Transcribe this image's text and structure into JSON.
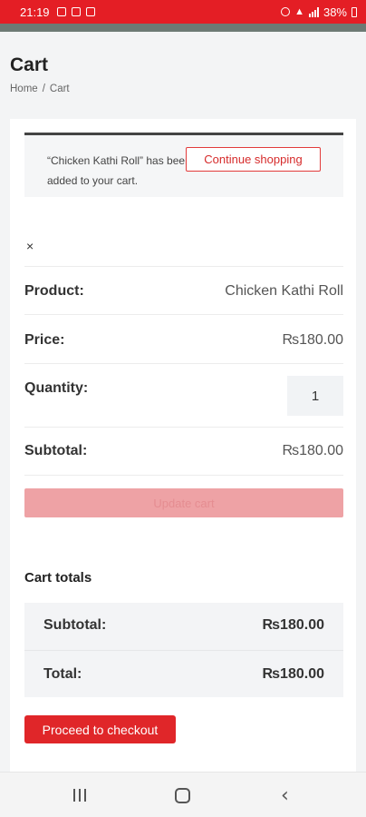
{
  "status_bar": {
    "time": "21:19",
    "battery": "38%",
    "icons": [
      "mail-icon",
      "message-icon",
      "gallery-icon",
      "alarm-icon",
      "wifi-icon",
      "signal-icon",
      "battery-icon"
    ]
  },
  "page": {
    "title": "Cart",
    "breadcrumb": {
      "home": "Home",
      "separator": "/",
      "current": "Cart"
    }
  },
  "notice": {
    "message": "“Chicken Kathi Roll” has been added to your cart.",
    "button": "Continue shopping"
  },
  "cart_item": {
    "remove": "×",
    "product_label": "Product:",
    "product_value": "Chicken Kathi Roll",
    "price_label": "Price:",
    "price_value": "₨180.00",
    "quantity_label": "Quantity:",
    "quantity_value": "1",
    "subtotal_label": "Subtotal:",
    "subtotal_value": "₨180.00"
  },
  "update_cart_button": "Update cart",
  "totals": {
    "title": "Cart totals",
    "subtotal_label": "Subtotal:",
    "subtotal_value": "₨180.00",
    "total_label": "Total:",
    "total_value": "₨180.00"
  },
  "checkout_button": "Proceed to checkout",
  "colors": {
    "accent": "#e02629",
    "status_bar": "#e41e25"
  }
}
